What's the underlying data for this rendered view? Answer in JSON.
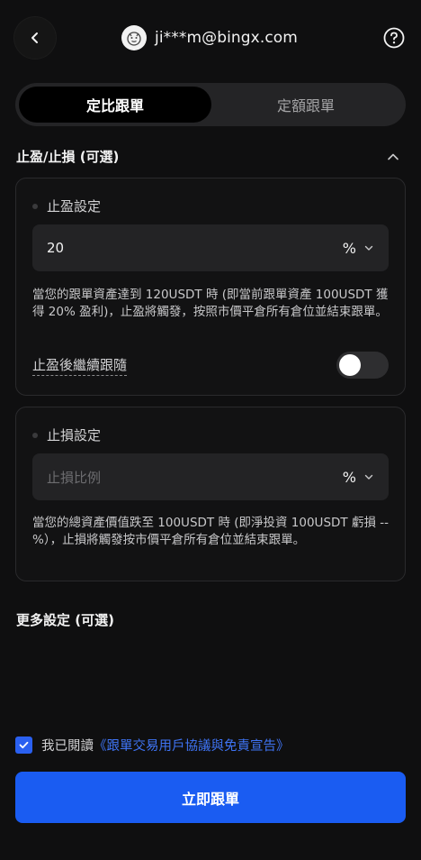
{
  "header": {
    "email": "ji***m@bingx.com",
    "icons": {
      "back": "chevron-left-icon",
      "help": "question-circle-icon",
      "avatar": "avatar"
    }
  },
  "mode_tabs": [
    {
      "label": "定比跟單",
      "active": true
    },
    {
      "label": "定額跟單",
      "active": false
    }
  ],
  "tp_sl": {
    "title": "止盈/止損 (可選)",
    "take_profit": {
      "label": "止盈設定",
      "value": "20",
      "unit": "%",
      "description": "當您的跟單資產達到 120USDT 時 (即當前跟單資產 100USDT 獲得 20% 盈利)，止盈將觸發，按照市價平倉所有倉位並結束跟單。",
      "follow_label": "止盈後繼續跟隨",
      "follow_enabled": false
    },
    "stop_loss": {
      "label": "止損設定",
      "placeholder": "止損比例",
      "unit": "%",
      "description": "當您的總資產價值跌至 100USDT 時 (即淨投資 100USDT 虧損 --%），止損將觸發按市價平倉所有倉位並結束跟單。"
    }
  },
  "more_settings": {
    "title": "更多設定 (可選)"
  },
  "agreement": {
    "checked": true,
    "prefix": "我已閱讀",
    "link": "《跟單交易用戶協議與免責宣告》"
  },
  "submit": {
    "label": "立即跟單"
  },
  "colors": {
    "accent": "#1a5cf2",
    "link": "#3f74f5",
    "background": "#0f0f10"
  }
}
